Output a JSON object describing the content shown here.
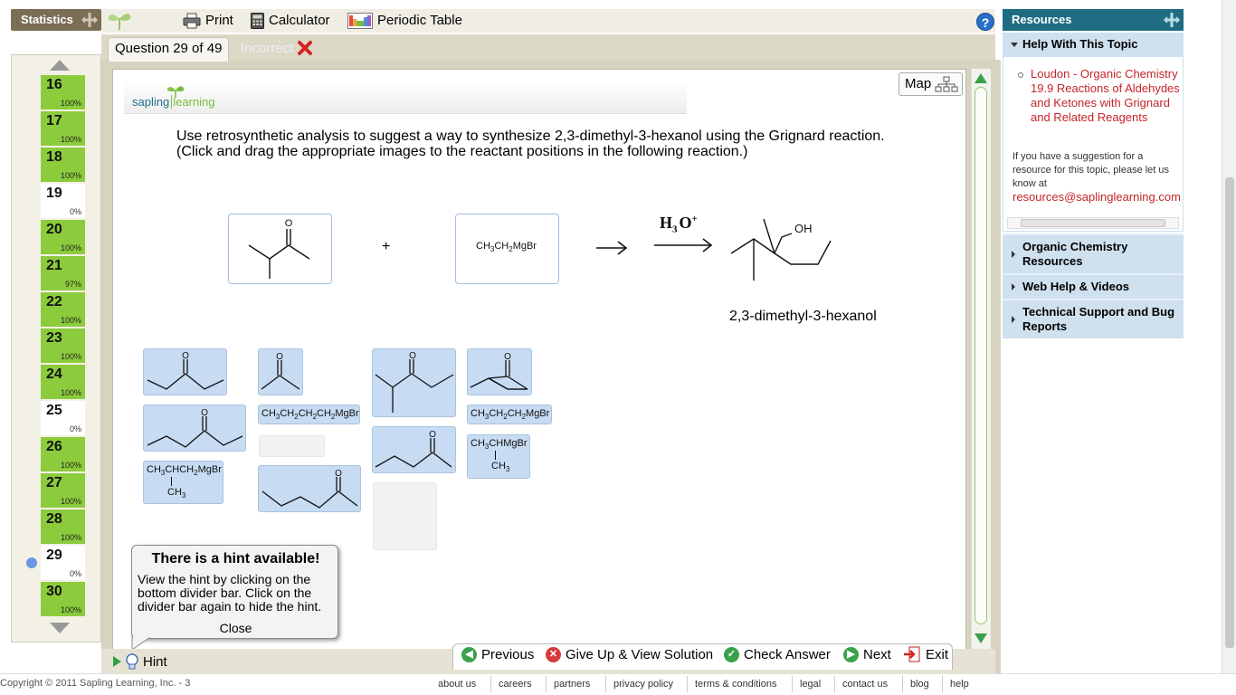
{
  "topbar": {
    "statistics_label": "Statistics",
    "print_label": "Print",
    "calculator_label": "Calculator",
    "periodic_table_label": "Periodic Table",
    "help_glyph": "?"
  },
  "question_nav": {
    "items": [
      {
        "num": "16",
        "pct": "100%",
        "status": "complete"
      },
      {
        "num": "17",
        "pct": "100%",
        "status": "complete"
      },
      {
        "num": "18",
        "pct": "100%",
        "status": "complete"
      },
      {
        "num": "19",
        "pct": "0%",
        "status": "none"
      },
      {
        "num": "20",
        "pct": "100%",
        "status": "complete"
      },
      {
        "num": "21",
        "pct": "97%",
        "status": "complete"
      },
      {
        "num": "22",
        "pct": "100%",
        "status": "complete"
      },
      {
        "num": "23",
        "pct": "100%",
        "status": "complete"
      },
      {
        "num": "24",
        "pct": "100%",
        "status": "complete"
      },
      {
        "num": "25",
        "pct": "0%",
        "status": "none"
      },
      {
        "num": "26",
        "pct": "100%",
        "status": "complete"
      },
      {
        "num": "27",
        "pct": "100%",
        "status": "complete"
      },
      {
        "num": "28",
        "pct": "100%",
        "status": "complete"
      },
      {
        "num": "29",
        "pct": "0%",
        "status": "current"
      },
      {
        "num": "30",
        "pct": "100%",
        "status": "complete"
      }
    ]
  },
  "tabs": {
    "question_label": "Question 29 of 49",
    "status_label": "Incorrect"
  },
  "content": {
    "logo_word1": "sapling",
    "logo_word2": "learning",
    "map_label": "Map",
    "question_text": "Use retrosynthetic analysis to suggest a way to synthesize 2,3-dimethyl-3-hexanol using the Grignard reaction. (Click and drag the appropriate images to the reactant positions in the following reaction.)",
    "plus": "+",
    "reagent_h": "H",
    "reagent_sub": "3",
    "reagent_o": "O",
    "reagent_sup": "+",
    "product_oh": "OH",
    "product_name": "2,3-dimethyl-3-hexanol",
    "carbonyl_o": "O",
    "dropped_grignard": {
      "a": "CH",
      "b": "3",
      "c": "CH",
      "d": "2",
      "e": "MgBr"
    },
    "tile_grignard_butyl": {
      "a": "CH",
      "b": "3",
      "c": "CH",
      "d": "2",
      "e": "CH",
      "f": "2",
      "g": "CH",
      "h": "2",
      "i": "MgBr"
    },
    "tile_grignard_propyl": {
      "a": "CH",
      "b": "3",
      "c": "CH",
      "d": "2",
      "e": "CH",
      "f": "2",
      "g": "MgBr"
    },
    "tile_grignard_isopropyl": {
      "a": "CH",
      "b": "3",
      "c": "CHCH",
      "d": "2",
      "e": "MgBr",
      "f": "CH",
      "g": "3"
    },
    "tile_grignard_secbutyl": {
      "a": "CH",
      "b": "3",
      "c": "CHMgBr",
      "d": "CH",
      "e": "3"
    }
  },
  "hint_bubble": {
    "title": "There is a hint available!",
    "text": "View the hint by clicking on the bottom divider bar. Click on the divider bar again to hide the hint.",
    "close_label": "Close"
  },
  "bottom": {
    "hint_label": "Hint",
    "previous_label": "Previous",
    "giveup_label": "Give Up & View Solution",
    "check_label": "Check Answer",
    "next_label": "Next",
    "exit_label": "Exit"
  },
  "resources": {
    "title": "Resources",
    "help_topic_label": "Help With This Topic",
    "link_text": "Loudon - Organic Chemistry 19.9 Reactions of Aldehydes and Ketones with Grignard and Related Reagents",
    "suggestion_text": "If you have a suggestion for a resource for this topic, please let us know at",
    "email": "resources@saplinglearning.com",
    "sections": [
      "Organic Chemistry Resources",
      "Web Help & Videos",
      "Technical Support and Bug Reports"
    ]
  },
  "footer": {
    "copyright": "Copyright © 2011 Sapling Learning, Inc. - 3",
    "links": [
      "about us",
      "careers",
      "partners",
      "privacy policy",
      "terms & conditions",
      "legal",
      "contact us",
      "blog",
      "help"
    ]
  },
  "colors": {
    "complete": "#8ccc3c",
    "resources_header": "#1f6d82",
    "link": "#c4252a",
    "tile": "#c7dbf2"
  }
}
